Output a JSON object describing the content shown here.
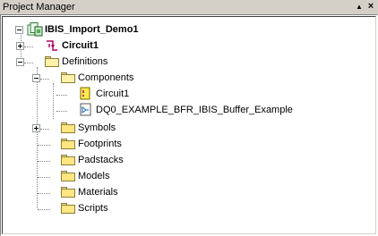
{
  "window": {
    "title": "Project Manager"
  },
  "titlebar_buttons": {
    "menu_glyph": "▲",
    "close_glyph": "×"
  },
  "tree": {
    "root": {
      "label": "IBIS_Import_Demo1",
      "icon": "project-icon"
    },
    "circuit": {
      "label": "Circuit1",
      "icon": "circuit-icon"
    },
    "definitions": {
      "label": "Definitions",
      "icon": "folder-icon"
    },
    "components": {
      "label": "Components",
      "icon": "folder-icon"
    },
    "component_items": [
      {
        "label": "Circuit1",
        "icon": "circuit-component-icon"
      },
      {
        "label": "DQ0_EXAMPLE_BFR_IBIS_Buffer_Example",
        "icon": "ibis-buffer-icon"
      }
    ],
    "symbols": {
      "label": "Symbols",
      "icon": "folder-icon"
    },
    "footprints": {
      "label": "Footprints",
      "icon": "folder-icon"
    },
    "padstacks": {
      "label": "Padstacks",
      "icon": "folder-icon"
    },
    "models": {
      "label": "Models",
      "icon": "folder-icon"
    },
    "materials": {
      "label": "Materials",
      "icon": "folder-icon"
    },
    "scripts": {
      "label": "Scripts",
      "icon": "folder-icon"
    }
  }
}
